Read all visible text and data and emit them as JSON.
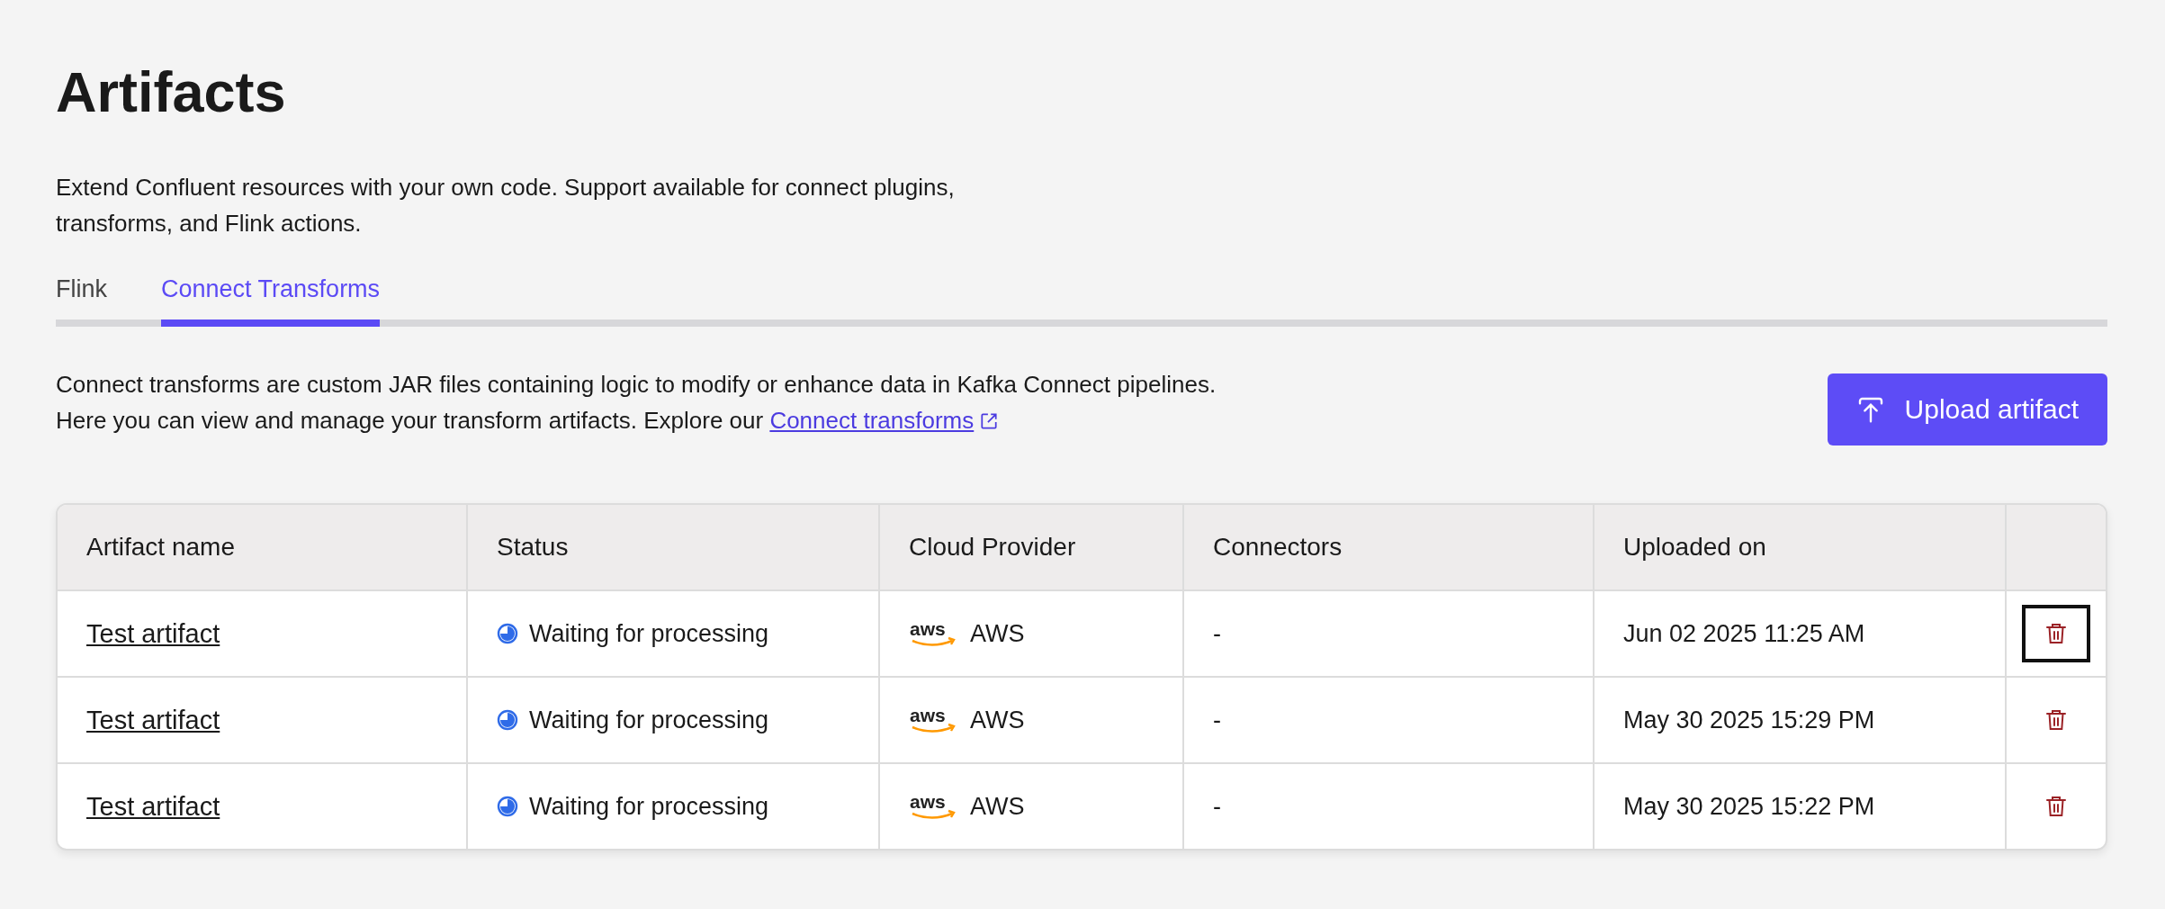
{
  "page": {
    "title": "Artifacts",
    "description": "Extend Confluent resources with your own code. Support available for connect plugins, transforms, and Flink actions."
  },
  "tabs": [
    {
      "label": "Flink",
      "selected": false
    },
    {
      "label": "Connect Transforms",
      "selected": true
    }
  ],
  "intro": {
    "text": "Connect transforms are custom JAR files containing logic to modify or enhance data in Kafka Connect pipelines. Here you can view and manage your transform artifacts. Explore our",
    "link": "Connect transforms"
  },
  "upload_button": {
    "label": "Upload artifact"
  },
  "table": {
    "columns": [
      "Artifact name",
      "Status",
      "Cloud Provider",
      "Connectors",
      "Uploaded on"
    ],
    "rows": [
      {
        "name": "Test artifact",
        "status": "Waiting for processing",
        "provider_logo": "aws",
        "provider": "AWS",
        "connectors": "-",
        "uploaded_on": "Jun 02 2025 11:25 AM",
        "delete_focused": true
      },
      {
        "name": "Test artifact",
        "status": "Waiting for processing",
        "provider_logo": "aws",
        "provider": "AWS",
        "connectors": "-",
        "uploaded_on": "May 30 2025 15:29 PM",
        "delete_focused": false
      },
      {
        "name": "Test artifact",
        "status": "Waiting for processing",
        "provider_logo": "aws",
        "provider": "AWS",
        "connectors": "-",
        "uploaded_on": "May 30 2025 15:22 PM",
        "delete_focused": false
      }
    ]
  }
}
